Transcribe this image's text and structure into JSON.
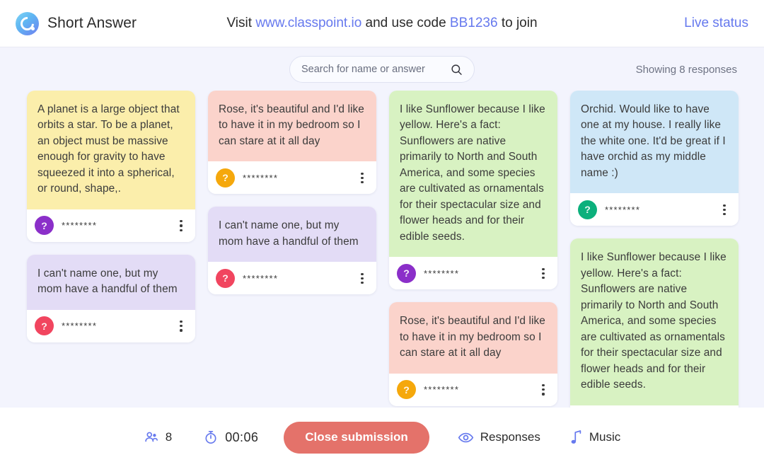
{
  "header": {
    "brand_title": "Short Answer",
    "logo_icon": "classpoint-logo-icon",
    "join_prefix": "Visit ",
    "join_url": "www.classpoint.io",
    "join_middle": " and use code ",
    "join_code": "BB1236",
    "join_suffix": " to join",
    "live_status": "Live status",
    "link_color": "#6679ee"
  },
  "search": {
    "placeholder": "Search for name or answer",
    "value": "",
    "icon": "search-icon",
    "showing": "Showing 8 responses"
  },
  "board": {
    "columns": [
      {
        "cards": [
          {
            "text": "A planet is a large object that orbits a star. To be a planet, an object must be massive enough for gravity to have squeezed it into a spherical, or round, shape,.",
            "bg": "#fbeeab",
            "avatar_color": "#8b2fc9",
            "avatar_glyph": "?",
            "name": "********",
            "menu_icon": "kebab-menu-icon"
          },
          {
            "text": "I can't name one, but my mom have a handful of them",
            "bg": "#e3dcf6",
            "avatar_color": "#f1455f",
            "avatar_glyph": "?",
            "name": "********",
            "menu_icon": "kebab-menu-icon"
          }
        ]
      },
      {
        "cards": [
          {
            "text": "Rose, it's beautiful and I'd like to have it in my bedroom so I can stare at it all day",
            "bg": "#fbd3cb",
            "avatar_color": "#f5a80c",
            "avatar_glyph": "?",
            "name": "********",
            "menu_icon": "kebab-menu-icon"
          },
          {
            "text": "I can't name one, but my mom have a handful of them",
            "bg": "#e3dcf6",
            "avatar_color": "#f1455f",
            "avatar_glyph": "?",
            "name": "********",
            "menu_icon": "kebab-menu-icon"
          }
        ]
      },
      {
        "cards": [
          {
            "text": "I like Sunflower because I like yellow. Here's a fact: Sunflowers are native primarily to North and South America, and some species are cultivated as ornamentals for their spectacular size and flower heads and for their edible seeds.",
            "bg": "#d8f2c2",
            "avatar_color": "#8b2fc9",
            "avatar_glyph": "?",
            "name": "********",
            "menu_icon": "kebab-menu-icon"
          },
          {
            "text": "Rose, it's beautiful and I'd like to have it in my bedroom so I can stare at it all day",
            "bg": "#fbd3cb",
            "avatar_color": "#f5a80c",
            "avatar_glyph": "?",
            "name": "********",
            "menu_icon": "kebab-menu-icon"
          }
        ]
      },
      {
        "cards": [
          {
            "text": "Orchid. Would like to have one at my house. I really like the white one. It'd be great if I have orchid as my middle name :)",
            "bg": "#cfe7f7",
            "avatar_color": "#0cb07c",
            "avatar_glyph": "?",
            "name": "********",
            "menu_icon": "kebab-menu-icon"
          },
          {
            "text": "I like Sunflower because I like yellow. Here's a fact: Sunflowers are native primarily to North and South America, and some species are cultivated as ornamentals for their spectacular size and flower heads and for their edible seeds.",
            "bg": "#d8f2c2",
            "avatar_color": "#8b2fc9",
            "avatar_glyph": "?",
            "name": "********",
            "menu_icon": "kebab-menu-icon"
          }
        ]
      }
    ]
  },
  "bottom_bar": {
    "participants_icon": "people-icon",
    "participants_count": "8",
    "timer_icon": "stopwatch-icon",
    "timer_value": "00:06",
    "close_label": "Close submission",
    "close_color": "#e4726a",
    "responses_icon": "eye-icon",
    "responses_label": "Responses",
    "music_icon": "music-note-icon",
    "music_label": "Music"
  }
}
